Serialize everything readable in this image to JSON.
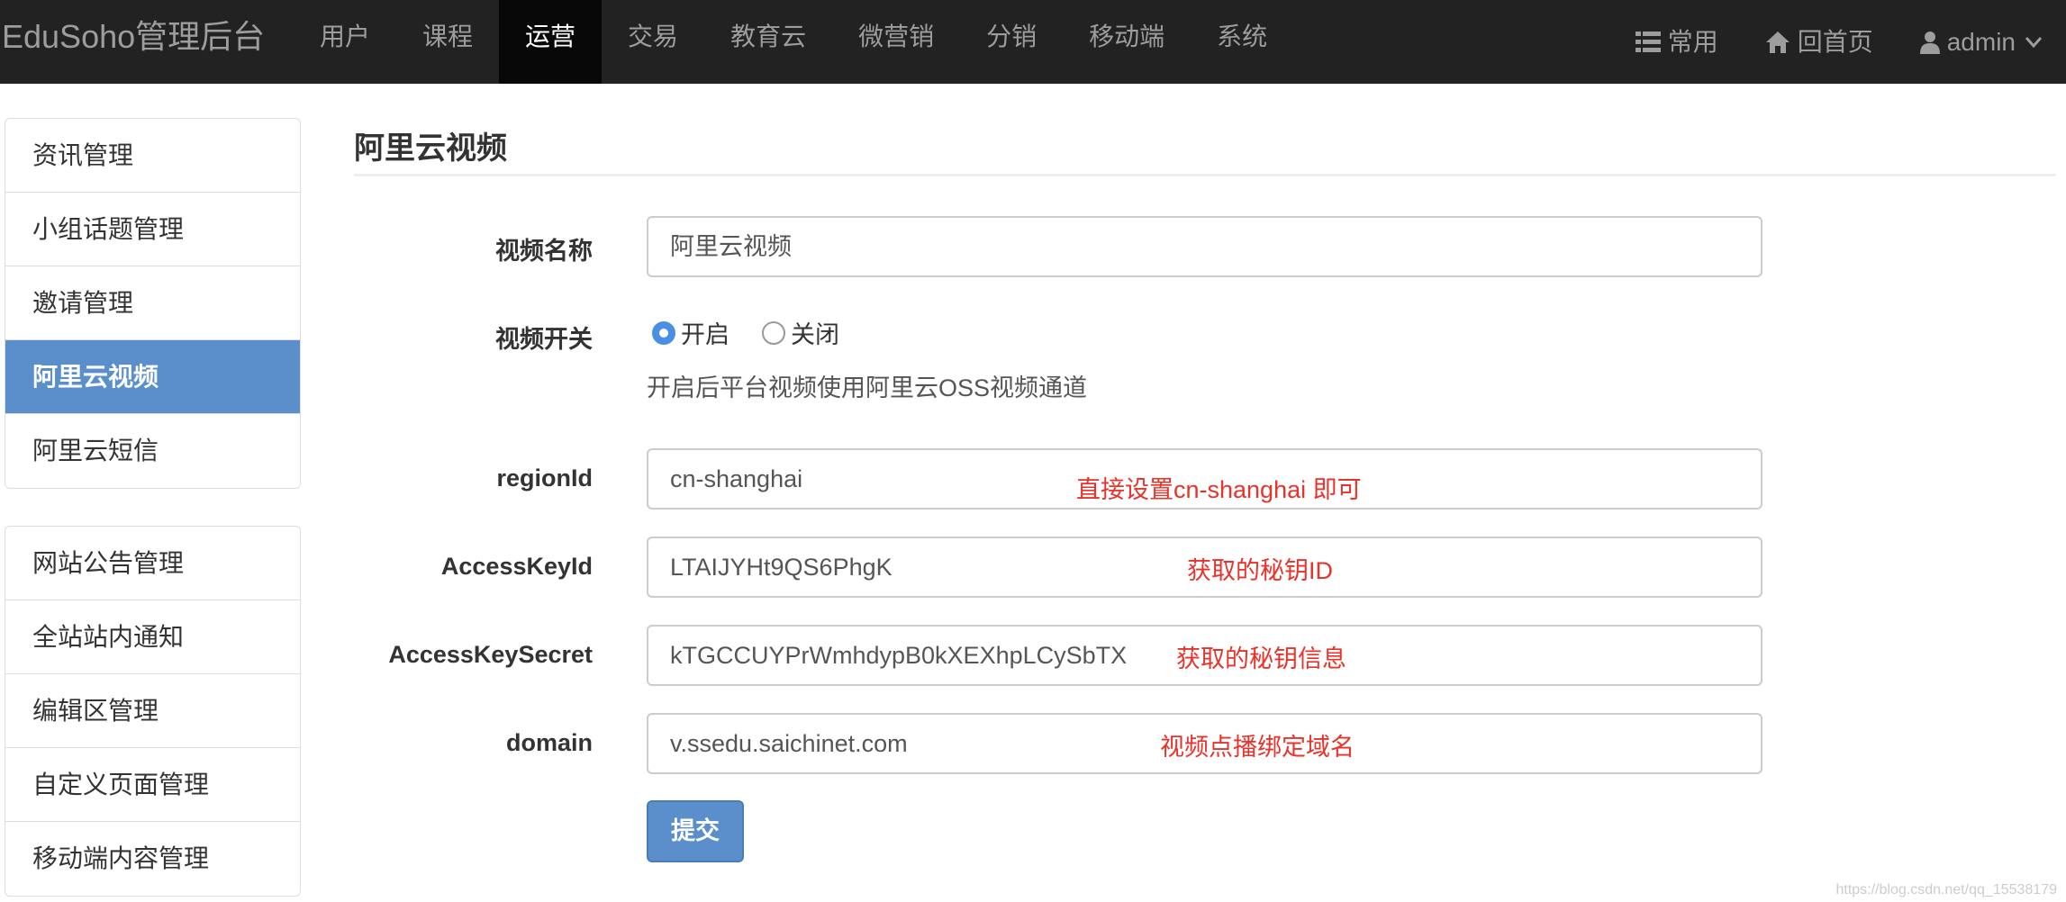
{
  "app": {
    "brand": "EduSoho管理后台"
  },
  "nav": {
    "items": [
      "用户",
      "课程",
      "运营",
      "交易",
      "教育云",
      "微营销",
      "分销",
      "移动端",
      "系统"
    ],
    "active": "运营",
    "right": {
      "common": "常用",
      "home": "回首页",
      "user": "admin"
    }
  },
  "sidebar": {
    "group1": [
      "资讯管理",
      "小组话题管理",
      "邀请管理",
      "阿里云视频",
      "阿里云短信"
    ],
    "group2": [
      "网站公告管理",
      "全站站内通知",
      "编辑区管理",
      "自定义页面管理",
      "移动端内容管理"
    ],
    "active": "阿里云视频"
  },
  "page": {
    "title": "阿里云视频"
  },
  "form": {
    "video_name": {
      "label": "视频名称",
      "value": "阿里云视频"
    },
    "video_switch": {
      "label": "视频开关",
      "on": "开启",
      "off": "关闭",
      "selected": "开启",
      "help": "开启后平台视频使用阿里云OSS视频通道"
    },
    "region_id": {
      "label": "regionId",
      "value": "cn-shanghai",
      "note": "直接设置cn-shanghai 即可"
    },
    "access_key_id": {
      "label": "AccessKeyId",
      "value": "LTAIJYHt9QS6PhgK",
      "note": "获取的秘钥ID"
    },
    "access_key_secret": {
      "label": "AccessKeySecret",
      "value": "kTGCCUYPrWmhdypB0kXEXhpLCySbTX",
      "note": "获取的秘钥信息"
    },
    "domain": {
      "label": "domain",
      "value": "v.ssedu.saichinet.com",
      "note": "视频点播绑定域名"
    },
    "submit_label": "提交"
  },
  "watermark": "https://blog.csdn.net/qq_15538179",
  "colors": {
    "navbar": "#222222",
    "accent": "#5a8fcc",
    "note": "#e8322a"
  },
  "icons": {
    "common": "list-icon",
    "home": "home-icon",
    "user": "user-icon",
    "caret": "chevron-down-icon"
  }
}
